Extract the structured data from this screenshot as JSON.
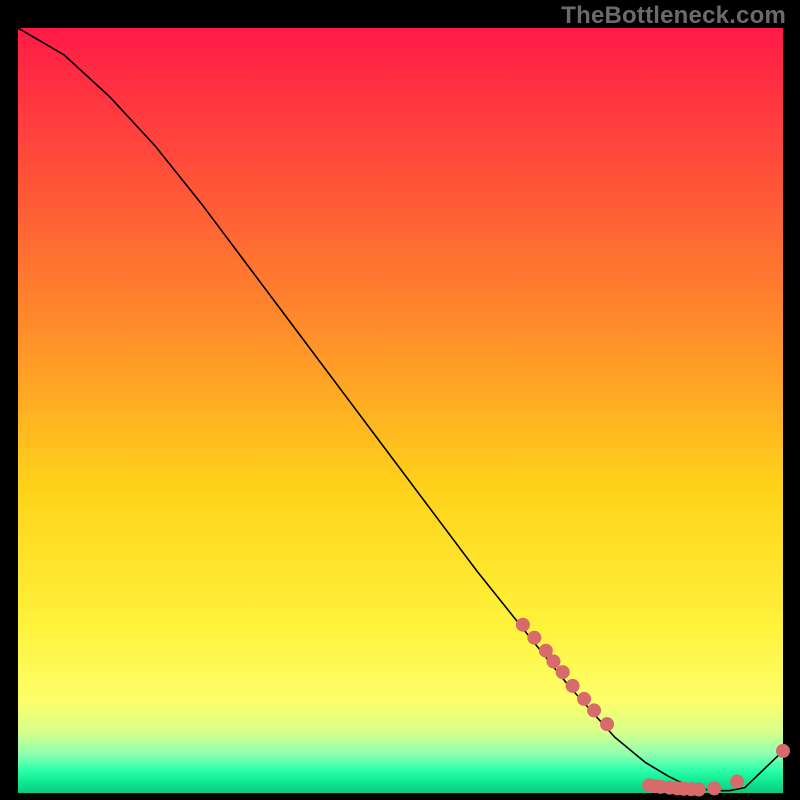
{
  "watermark": "TheBottleneck.com",
  "chart_data": {
    "type": "line",
    "title": "",
    "xlabel": "",
    "ylabel": "",
    "xlim": [
      0,
      100
    ],
    "ylim": [
      0,
      100
    ],
    "series": [
      {
        "name": "curve",
        "x": [
          0,
          6,
          12,
          18,
          24,
          30,
          36,
          42,
          48,
          54,
          60,
          66,
          72,
          78,
          82,
          85,
          87,
          89,
          91,
          93,
          95,
          100
        ],
        "y": [
          100,
          96.5,
          91,
          84.5,
          77,
          69,
          61,
          53,
          45,
          37,
          29,
          21.5,
          14,
          7.3,
          4,
          2.2,
          1.2,
          0.6,
          0.3,
          0.3,
          0.7,
          5.5
        ]
      }
    ],
    "markers": {
      "name": "dots",
      "color": "#d76a6a",
      "radius": 7,
      "points": [
        {
          "x": 66.0,
          "y": 22.0
        },
        {
          "x": 67.5,
          "y": 20.3
        },
        {
          "x": 69.0,
          "y": 18.6
        },
        {
          "x": 70.0,
          "y": 17.2
        },
        {
          "x": 71.2,
          "y": 15.8
        },
        {
          "x": 72.5,
          "y": 14.0
        },
        {
          "x": 74.0,
          "y": 12.3
        },
        {
          "x": 75.3,
          "y": 10.8
        },
        {
          "x": 77.0,
          "y": 9.0
        },
        {
          "x": 82.5,
          "y": 1.0
        },
        {
          "x": 83.2,
          "y": 0.9
        },
        {
          "x": 84.0,
          "y": 0.8
        },
        {
          "x": 85.2,
          "y": 0.7
        },
        {
          "x": 86.2,
          "y": 0.6
        },
        {
          "x": 87.0,
          "y": 0.55
        },
        {
          "x": 88.0,
          "y": 0.5
        },
        {
          "x": 89.0,
          "y": 0.45
        },
        {
          "x": 91.0,
          "y": 0.6
        },
        {
          "x": 94.0,
          "y": 1.5
        },
        {
          "x": 100.0,
          "y": 5.5
        }
      ]
    }
  }
}
